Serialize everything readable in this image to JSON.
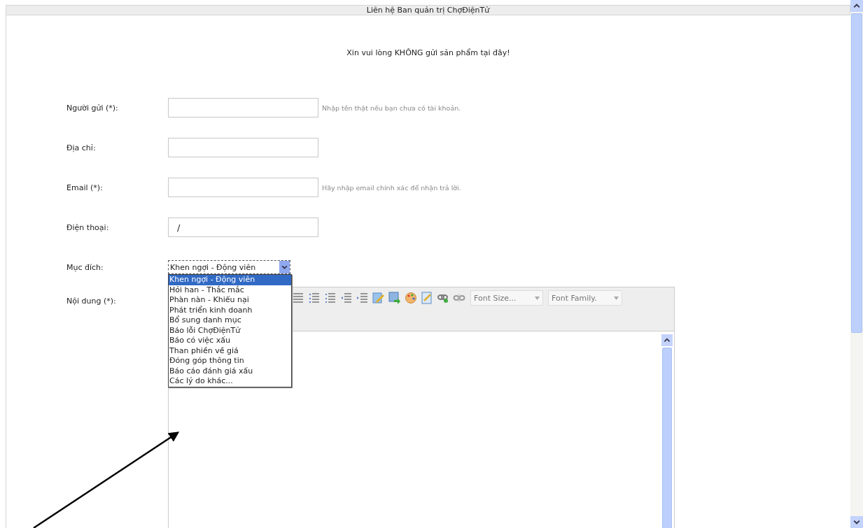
{
  "window": {
    "title": "Liên hệ Ban quản trị ChợĐiệnTử"
  },
  "notice": "Xin vui lòng KHÔNG gửi sản phẩm tại đây!",
  "fields": [
    {
      "label": "Người gửi (*):",
      "hint": "Nhập tên thật nếu bạn chưa có tài khoản."
    },
    {
      "label": "Địa chỉ:"
    },
    {
      "label": "Email (*):",
      "hint": "Hãy nhập email chính xác để nhận trả lời."
    },
    {
      "label": "Điện thoại:",
      "value": "/"
    }
  ],
  "purpose": {
    "label": "Mục đích:",
    "value": "Khen ngợi - Động viên",
    "expanded": true,
    "options": [
      {
        "label": "Khen ngợi - Động viên",
        "selected": true
      },
      {
        "label": "Hỏi han - Thắc mắc",
        "selected": false
      },
      {
        "label": "Phàn nàn - Khiếu nại",
        "selected": false
      },
      {
        "label": "Phát triển kinh doanh",
        "selected": false
      },
      {
        "label": "Bổ sung danh mục",
        "selected": false
      },
      {
        "label": "Báo lỗi ChợĐiệnTử",
        "selected": false
      },
      {
        "label": "Báo có việc xấu",
        "selected": false
      },
      {
        "label": "Than phiền về giá",
        "selected": false
      },
      {
        "label": "Đóng góp thông tin",
        "selected": false
      },
      {
        "label": "Báo cáo đánh giá xấu",
        "selected": false
      },
      {
        "label": "Các lý do khác...",
        "selected": false
      }
    ]
  },
  "content": {
    "label": "Nội dung (*):",
    "font_size": "Font Size...",
    "font_family": "Font Family."
  }
}
